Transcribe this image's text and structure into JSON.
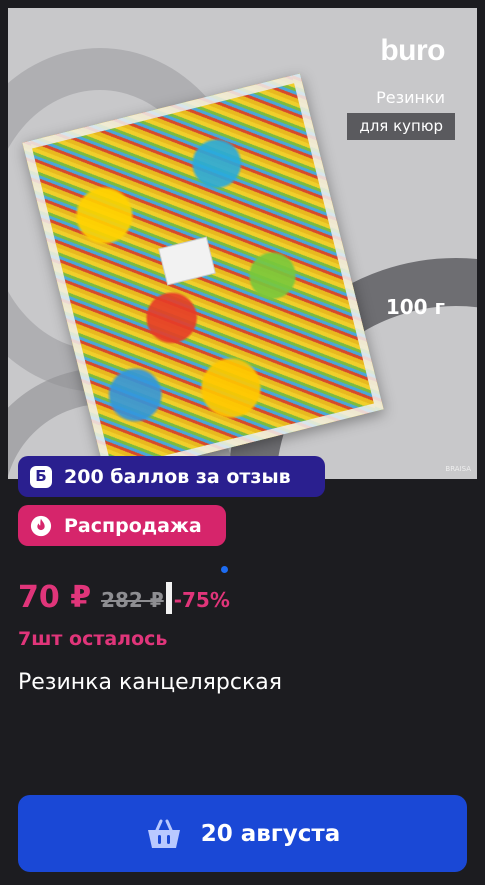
{
  "product_image": {
    "brand": "buro",
    "line1": "Резинки",
    "line2": "для купюр",
    "weight": "100 г",
    "watermark": "BRAISA"
  },
  "badges": {
    "points": {
      "icon_letter": "Б",
      "label": "200 баллов за отзыв",
      "color": "#2a1f8f",
      "icon": "points-b-icon"
    },
    "sale": {
      "label": "Распродажа",
      "color": "#d6256b",
      "icon": "fire-icon"
    }
  },
  "carousel": {
    "current": 1
  },
  "price": {
    "current": "70 ₽",
    "old": "282 ₽",
    "discount": "-75%",
    "accent": "#e0357a"
  },
  "stock": "7шт осталось",
  "title": "Резинка канцелярская",
  "cart_button": {
    "label": "20 августа",
    "icon": "basket-icon",
    "color": "#1a48d6"
  }
}
